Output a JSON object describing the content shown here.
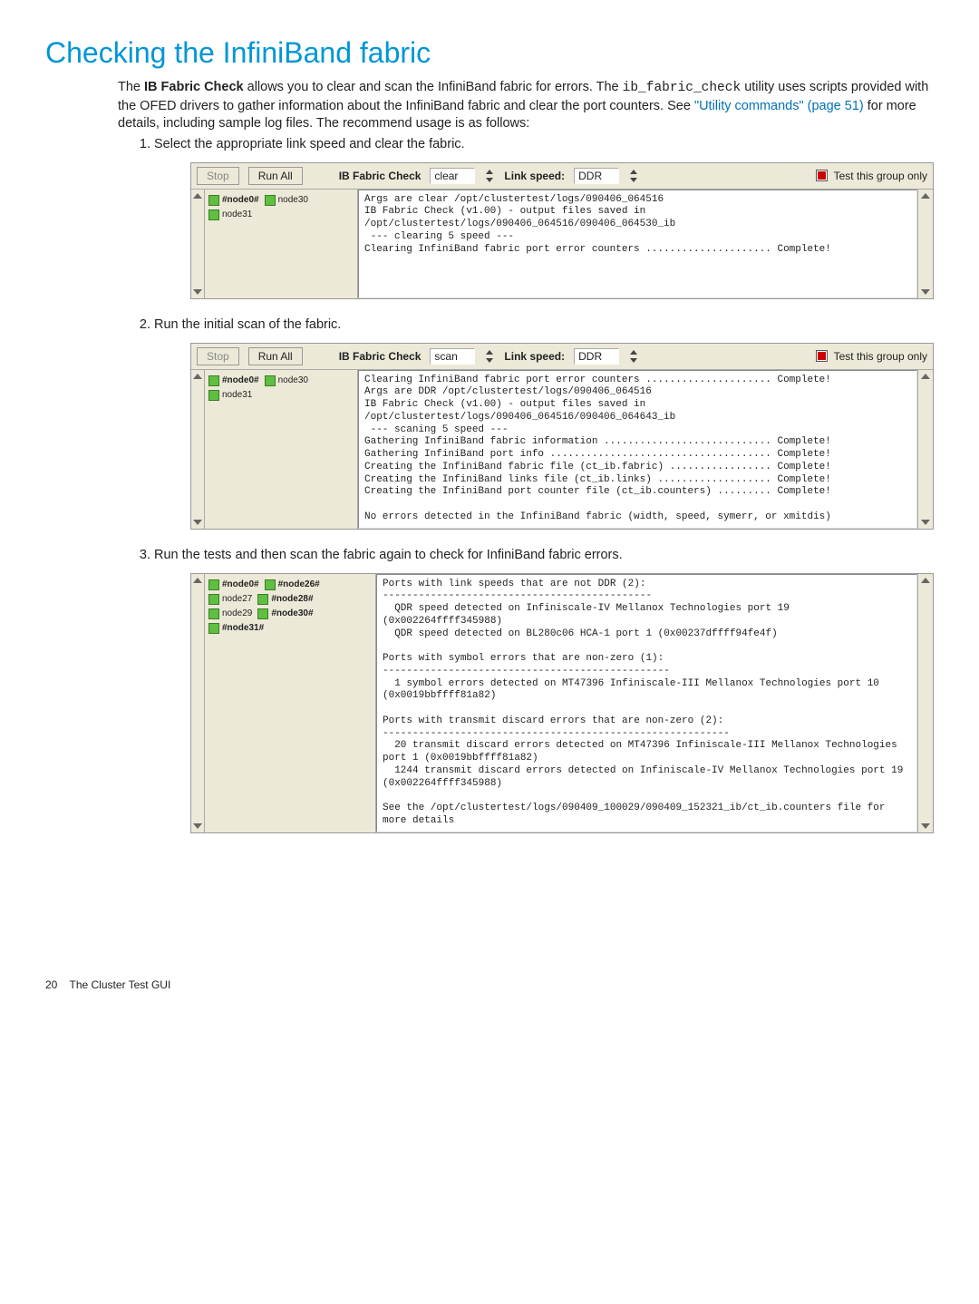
{
  "title": "Checking the InfiniBand fabric",
  "intro": {
    "l1a": "The ",
    "l1b": "IB Fabric Check",
    "l1c": " allows you to clear and scan the InfiniBand fabric for errors. The ",
    "l2a": "ib_fabric_check",
    "l2b": " utility uses scripts provided with the OFED drivers to gather information about the InfiniBand fabric and clear the port counters. See ",
    "l2link": "\"Utility commands\" (page 51)",
    "l2c": " for more details, including sample log files. The recommend usage is as follows:"
  },
  "steps": {
    "s1": "Select the appropriate link speed and clear the fabric.",
    "s2": "Run the initial scan of the fabric.",
    "s3": "Run the tests and then scan the fabric again to check for InfiniBand fabric errors."
  },
  "toolbar": {
    "stop": "Stop",
    "runall": "Run All",
    "ibcheck": "IB Fabric Check",
    "linkspeed": "Link speed:",
    "ddr": "DDR",
    "testgroup": "Test this group only"
  },
  "fig1": {
    "mode": "clear",
    "nodes": [
      "#node0#",
      "node30",
      "node31"
    ],
    "log": "Args are clear /opt/clustertest/logs/090406_064516\nIB Fabric Check (v1.00) - output files saved in\n/opt/clustertest/logs/090406_064516/090406_064530_ib\n --- clearing 5 speed ---\nClearing InfiniBand fabric port error counters ..................... Complete!"
  },
  "fig2": {
    "mode": "scan",
    "nodes": [
      "#node0#",
      "node30",
      "node31"
    ],
    "log": "Clearing InfiniBand fabric port error counters ..................... Complete!\nArgs are DDR /opt/clustertest/logs/090406_064516\nIB Fabric Check (v1.00) - output files saved in\n/opt/clustertest/logs/090406_064516/090406_064643_ib\n --- scaning 5 speed ---\nGathering InfiniBand fabric information ............................ Complete!\nGathering InfiniBand port info ..................................... Complete!\nCreating the InfiniBand fabric file (ct_ib.fabric) ................. Complete!\nCreating the InfiniBand links file (ct_ib.links) ................... Complete!\nCreating the InfiniBand port counter file (ct_ib.counters) ......... Complete!\n\nNo errors detected in the InfiniBand fabric (width, speed, symerr, or xmitdis)"
  },
  "fig3": {
    "nodes_left": [
      "#node0#",
      "node27",
      "node29",
      "#node31#"
    ],
    "nodes_right": [
      "#node26#",
      "#node28#",
      "#node30#"
    ],
    "log": "Ports with link speeds that are not DDR (2):\n---------------------------------------------\n  QDR speed detected on Infiniscale-IV Mellanox Technologies port 19 (0x002264ffff345988)\n  QDR speed detected on BL280c06 HCA-1 port 1 (0x00237dffff94fe4f)\n\nPorts with symbol errors that are non-zero (1):\n------------------------------------------------\n  1 symbol errors detected on MT47396 Infiniscale-III Mellanox Technologies port 10 (0x0019bbffff81a82)\n\nPorts with transmit discard errors that are non-zero (2):\n----------------------------------------------------------\n  20 transmit discard errors detected on MT47396 Infiniscale-III Mellanox Technologies port 1 (0x0019bbffff81a82)\n  1244 transmit discard errors detected on Infiniscale-IV Mellanox Technologies port 19 (0x002264ffff345988)\n\nSee the /opt/clustertest/logs/090409_100029/090409_152321_ib/ct_ib.counters file for more details"
  },
  "footer": {
    "page": "20",
    "label": "The Cluster Test GUI"
  }
}
